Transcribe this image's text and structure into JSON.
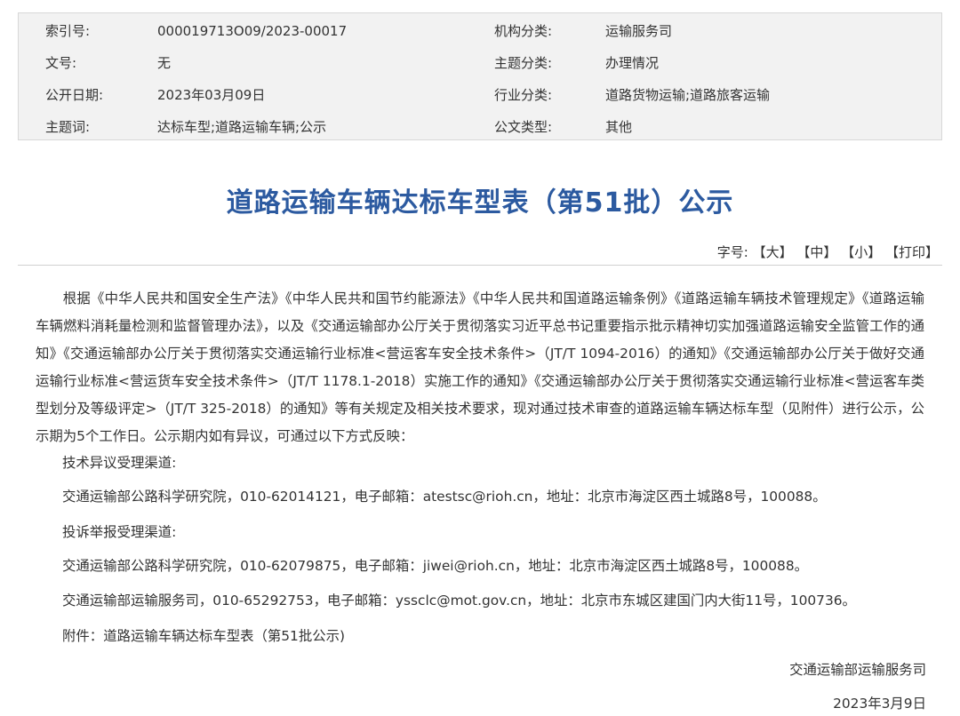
{
  "meta": {
    "rows": [
      {
        "l_label": "索引号:",
        "l_value": "000019713O09/2023-00017",
        "r_label": "机构分类:",
        "r_value": "运输服务司"
      },
      {
        "l_label": "文号:",
        "l_value": "无",
        "r_label": "主题分类:",
        "r_value": "办理情况"
      },
      {
        "l_label": "公开日期:",
        "l_value": "2023年03月09日",
        "r_label": "行业分类:",
        "r_value": "道路货物运输;道路旅客运输"
      },
      {
        "l_label": "主题词:",
        "l_value": "达标车型;道路运输车辆;公示",
        "r_label": "公文类型:",
        "r_value": "其他"
      }
    ]
  },
  "article": {
    "title": "道路运输车辆达标车型表（第51批）公示",
    "font_label": "字号:",
    "font_large": "【大】",
    "font_medium": "【中】",
    "font_small": "【小】",
    "print": "【打印】",
    "intro": "根据《中华人民共和国安全生产法》《中华人民共和国节约能源法》《中华人民共和国道路运输条例》《道路运输车辆技术管理规定》《道路运输车辆燃料消耗量检测和监督管理办法》，以及《交通运输部办公厅关于贯彻落实习近平总书记重要指示批示精神切实加强道路运输安全监管工作的通知》《交通运输部办公厅关于贯彻落实交通运输行业标准<营运客车安全技术条件>（JT/T 1094-2016）的通知》《交通运输部办公厅关于做好交通运输行业标准<营运货车安全技术条件>（JT/T 1178.1-2018）实施工作的通知》《交通运输部办公厅关于贯彻落实交通运输行业标准<营运客车类型划分及等级评定>（JT/T 325-2018）的通知》等有关规定及相关技术要求，现对通过技术审查的道路运输车辆达标车型（见附件）进行公示，公示期为5个工作日。公示期内如有异议，可通过以下方式反映：",
    "tech_heading": "技术异议受理渠道:",
    "tech_contact": "交通运输部公路科学研究院，010-62014121，电子邮箱：atestsc@rioh.cn，地址：北京市海淀区西土城路8号，100088。",
    "complaint_heading": "投诉举报受理渠道:",
    "complaint_contact_1": "交通运输部公路科学研究院，010-62079875，电子邮箱：jiwei@rioh.cn，地址：北京市海淀区西土城路8号，100088。",
    "complaint_contact_2": "交通运输部运输服务司，010-65292753，电子邮箱：yssclc@mot.gov.cn，地址：北京市东城区建国门内大街11号，100736。",
    "attachment_label": "附件：",
    "attachment_link": "道路运输车辆达标车型表（第51批公示)",
    "signature": "交通运输部运输服务司",
    "date": "2023年3月9日"
  },
  "colors": {
    "title": "#2c5aa0",
    "meta_bg": "#f2f2f2"
  }
}
